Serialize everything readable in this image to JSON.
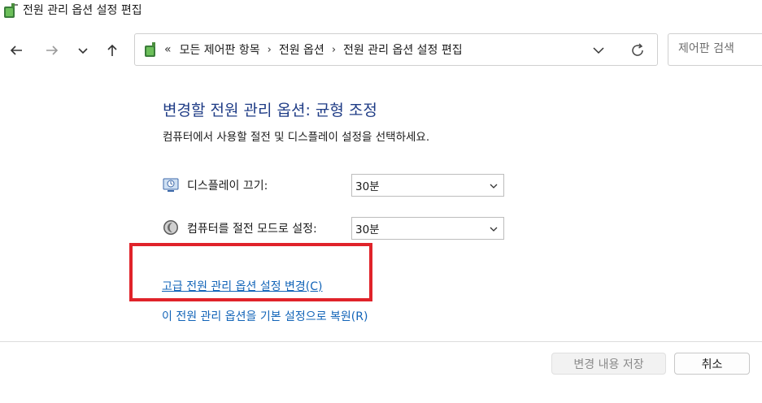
{
  "window": {
    "title": "전원 관리 옵션 설정 편집"
  },
  "nav": {
    "back_icon": "arrow-left-icon",
    "forward_icon": "arrow-right-icon",
    "recent_icon": "chevron-down-icon",
    "up_icon": "arrow-up-icon"
  },
  "address": {
    "overflow": "«",
    "crumbs": [
      "모든 제어판 항목",
      "전원 옵션",
      "전원 관리 옵션 설정 편집"
    ],
    "separator": "›"
  },
  "search": {
    "placeholder": "제어판 검색"
  },
  "content": {
    "heading": "변경할 전원 관리 옵션: 균형 조정",
    "subtitle": "컴퓨터에서 사용할 절전 및 디스플레이 설정을 선택하세요.",
    "display_off": {
      "label": "디스플레이 끄기:",
      "value": "30분"
    },
    "sleep": {
      "label": "컴퓨터를 절전 모드로 설정:",
      "value": "30분"
    },
    "advanced_link": "고급 전원 관리 옵션 설정 변경(C)",
    "restore_link": "이 전원 관리 옵션을 기본 설정으로 복원(R)"
  },
  "buttons": {
    "save": "변경 내용 저장",
    "cancel": "취소"
  },
  "colors": {
    "heading": "#1f3c86",
    "link": "#1264b8",
    "highlight": "#e0232a"
  }
}
